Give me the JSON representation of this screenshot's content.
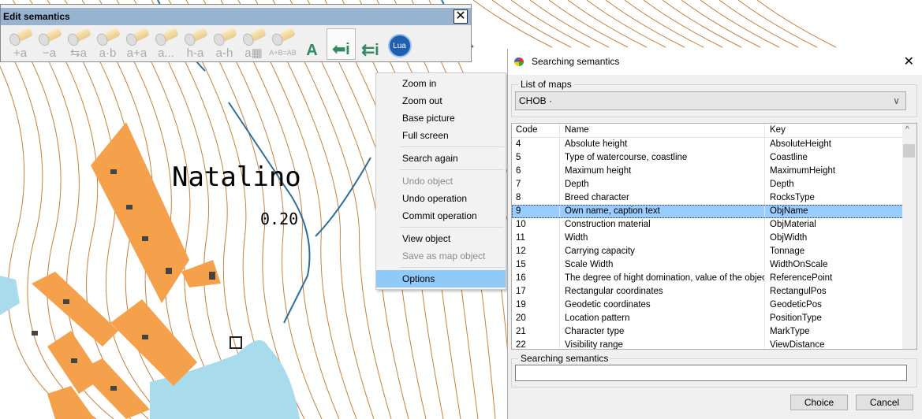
{
  "map": {
    "place_label": "Natalino",
    "value_label": "0.20",
    "colors": {
      "contour": "#c8803a",
      "water": "#2a6e9a",
      "lake": "#a8dcec",
      "building": "#f5a04a"
    }
  },
  "toolbar": {
    "title": "Edit semantics",
    "close": "✕",
    "buttons": [
      {
        "label": "+a",
        "icon": "flashlight-icon",
        "enabled": false
      },
      {
        "label": "−a",
        "icon": "flashlight-icon",
        "enabled": false
      },
      {
        "label": "⇆a",
        "icon": "flashlight-icon",
        "enabled": false
      },
      {
        "label": "a·b",
        "icon": "flashlight-icon",
        "enabled": false
      },
      {
        "label": "a+a",
        "icon": "flashlight-icon",
        "enabled": false
      },
      {
        "label": "a...",
        "icon": "flashlight-icon",
        "enabled": false
      },
      {
        "label": "h-a",
        "icon": "flashlight-icon",
        "enabled": false
      },
      {
        "label": "a-h",
        "icon": "flashlight-icon",
        "enabled": false
      },
      {
        "label": "a▦",
        "icon": "flashlight-calculator-icon",
        "enabled": false
      },
      {
        "label": "A+B=AB",
        "icon": "flashlight-icon",
        "enabled": false
      },
      {
        "label": "A",
        "icon": "text-to-object-icon",
        "enabled": true
      },
      {
        "label": "⬅i",
        "icon": "info-arrow-icon",
        "enabled": true,
        "selected": true
      },
      {
        "label": "⇇i",
        "icon": "multi-info-arrow-icon",
        "enabled": true
      },
      {
        "label": "Lua",
        "icon": "lua-icon",
        "enabled": true
      }
    ]
  },
  "context_menu": {
    "items": [
      {
        "label": "Zoom in"
      },
      {
        "label": "Zoom out"
      },
      {
        "label": "Base picture"
      },
      {
        "label": "Full screen"
      },
      {
        "label": "Search again"
      },
      {
        "label": "Undo object",
        "disabled": true
      },
      {
        "label": "Undo operation"
      },
      {
        "label": "Commit operation"
      },
      {
        "label": "View object"
      },
      {
        "label": "Save as map object",
        "disabled": true
      },
      {
        "label": "Options",
        "highlighted": true
      }
    ]
  },
  "dialog": {
    "title": "Searching semantics",
    "close": "✕",
    "maps_group": "List of maps",
    "map_selected": "CHOB ·",
    "columns": [
      "Code",
      "Name",
      "Key"
    ],
    "rows": [
      [
        "4",
        "Absolute height",
        "AbsoluteHeight"
      ],
      [
        "5",
        "Type of watercourse, coastline",
        "Coastline"
      ],
      [
        "6",
        "Maximum height",
        "MaximumHeight"
      ],
      [
        "7",
        "Depth",
        "Depth"
      ],
      [
        "8",
        "Breed character",
        "RocksType"
      ],
      [
        "9",
        "Own name, caption text",
        "ObjName"
      ],
      [
        "10",
        "Construction material",
        "ObjMaterial"
      ],
      [
        "11",
        "Width",
        "ObjWidth"
      ],
      [
        "12",
        "Carrying capacity",
        "Tonnage"
      ],
      [
        "15",
        "Scale Width",
        "WidthOnScale"
      ],
      [
        "16",
        "The degree of hight domination, value of the object a",
        "ReferencePoint"
      ],
      [
        "17",
        "Rectangular coordinates",
        "RectangulPos"
      ],
      [
        "19",
        "Geodetic coordinates",
        "GeodeticPos"
      ],
      [
        "20",
        "Location pattern",
        "PositionType"
      ],
      [
        "21",
        "Character type",
        "MarkType"
      ],
      [
        "22",
        "Visibility range",
        "ViewDistance"
      ]
    ],
    "selected_row": "9",
    "search_group": "Searching semantics",
    "search_value": "",
    "choice": "Choice",
    "cancel": "Cancel"
  }
}
